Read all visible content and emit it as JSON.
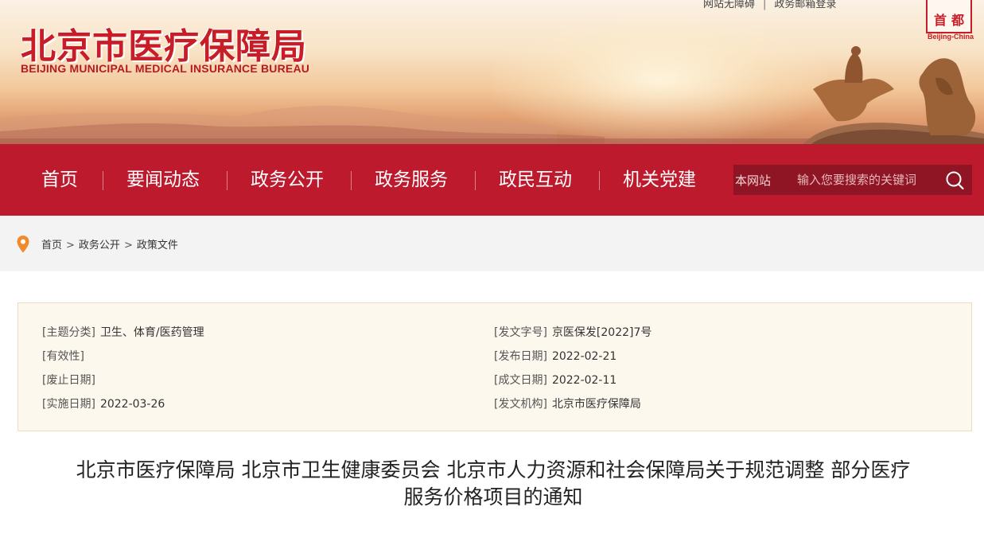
{
  "site": {
    "title_cn": "北京市医疗保障局",
    "title_en": "BEIJING MUNICIPAL MEDICAL INSURANCE BUREAU",
    "top_links": [
      "网站无障碍",
      "政务邮箱登录"
    ],
    "top_separator": "|",
    "seal_chars": [
      "首",
      "都"
    ],
    "seal_en": "Beijing-China"
  },
  "nav": {
    "items": [
      "首页",
      "要闻动态",
      "政务公开",
      "政务服务",
      "政民互动",
      "机关党建"
    ],
    "search": {
      "scope": "本网站",
      "placeholder": "输入您要搜索的关键词",
      "icon": "search-icon"
    }
  },
  "breadcrumb": {
    "icon": "location-pin-icon",
    "items": [
      "首页",
      "政务公开",
      "政策文件"
    ],
    "separator": ">"
  },
  "meta": {
    "left": [
      {
        "label": "[主题分类]",
        "value": "卫生、体育/医药管理"
      },
      {
        "label": "[有效性]",
        "value": ""
      },
      {
        "label": "[废止日期]",
        "value": ""
      },
      {
        "label": "[实施日期]",
        "value": "2022-03-26"
      }
    ],
    "right": [
      {
        "label": "[发文字号]",
        "value": "京医保发[2022]7号"
      },
      {
        "label": "[发布日期]",
        "value": "2022-02-21"
      },
      {
        "label": "[成文日期]",
        "value": "2022-02-11"
      },
      {
        "label": "[发文机构]",
        "value": "北京市医疗保障局"
      }
    ]
  },
  "article": {
    "title_line1": "北京市医疗保障局 北京市卫生健康委员会 北京市人力资源和社会保障局关于规范调整 部分医疗",
    "title_line2": "服务价格项目的通知"
  },
  "colors": {
    "brand_red": "#be1a2e",
    "search_bg": "#8f1524",
    "meta_bg": "#fdf8ee",
    "pin_orange": "#f08a2c"
  }
}
